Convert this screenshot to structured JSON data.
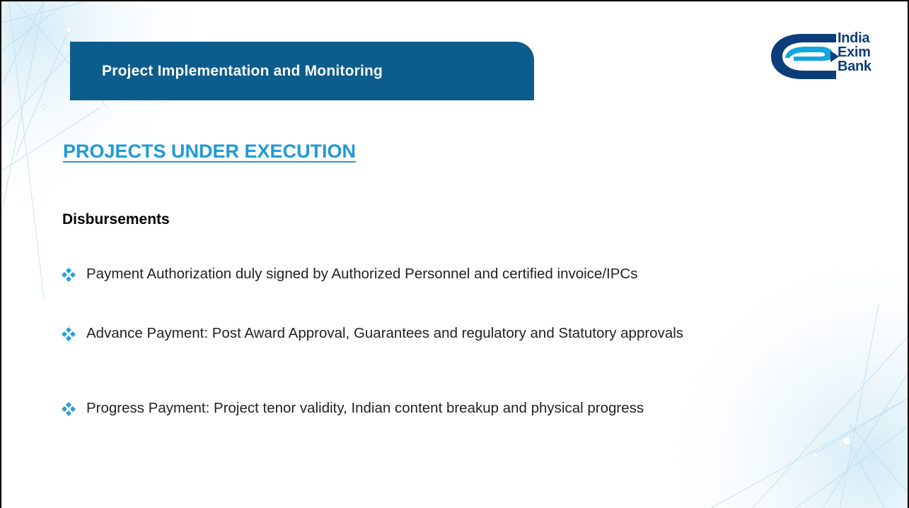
{
  "header": {
    "title": "Project Implementation and Monitoring"
  },
  "logo": {
    "lines": [
      "India",
      "Exim",
      "Bank"
    ],
    "colors": {
      "blue": "#0b3d7a",
      "cyan": "#14a6de"
    }
  },
  "content": {
    "section_heading": "PROJECTS UNDER EXECUTION",
    "sub_heading": "Disbursements",
    "bullet_icon": "diamond-bullet-icon",
    "bullets": [
      "Payment Authorization duly signed by Authorized Personnel and certified invoice/IPCs",
      "Advance Payment: Post Award Approval, Guarantees and regulatory and Statutory approvals",
      "Progress Payment: Project tenor validity, Indian content breakup and physical progress"
    ]
  },
  "colors": {
    "banner": "#0c5c8c",
    "heading": "#1f9ad6",
    "bullet": "#2a9fd8"
  }
}
